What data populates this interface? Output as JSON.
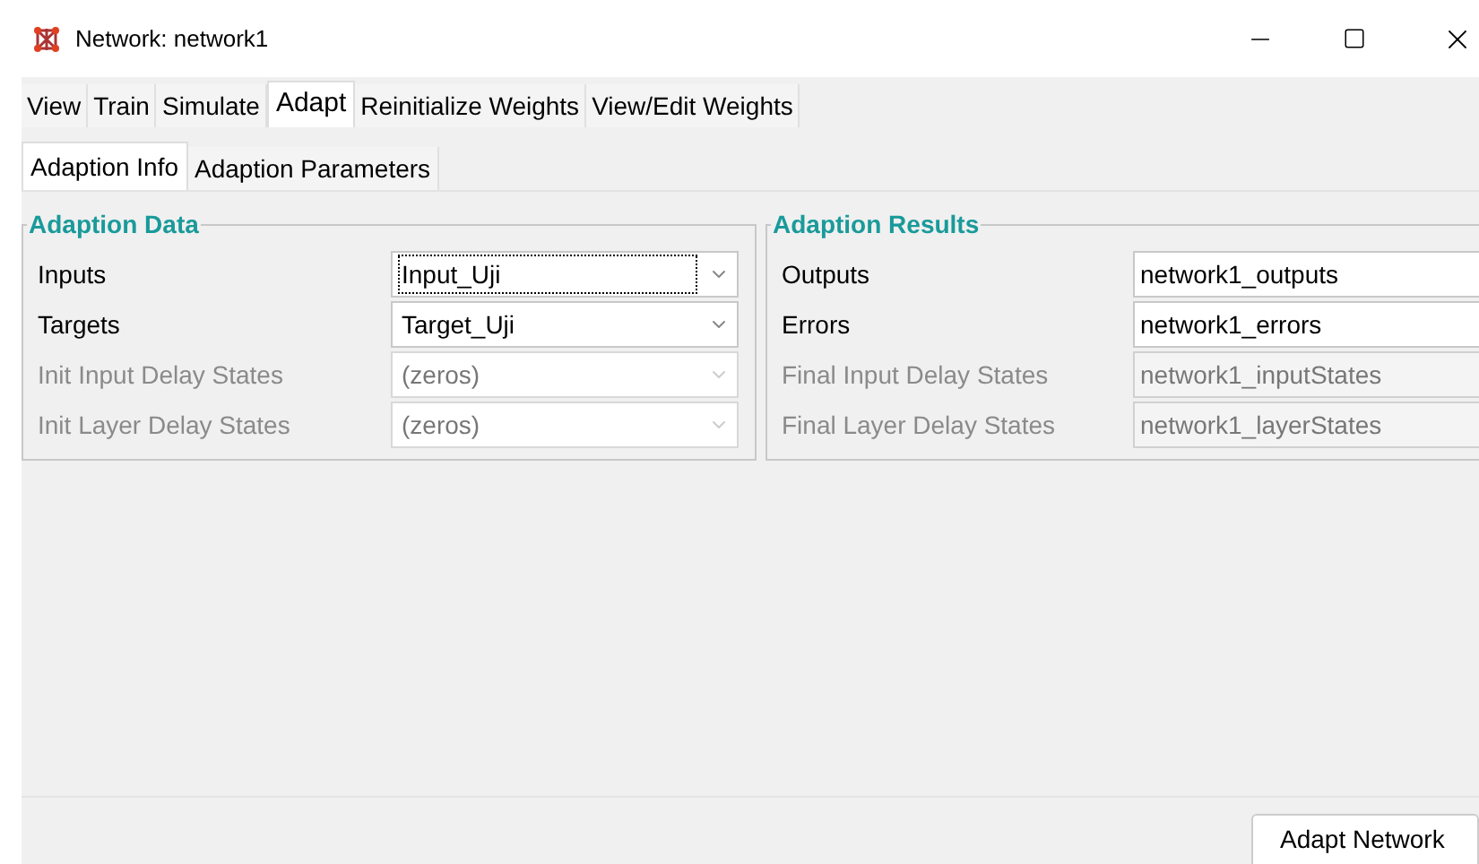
{
  "window": {
    "title": "Network: network1"
  },
  "tabs": [
    {
      "label": "View",
      "selected": false
    },
    {
      "label": "Train",
      "selected": false
    },
    {
      "label": "Simulate",
      "selected": false
    },
    {
      "label": "Adapt",
      "selected": true
    },
    {
      "label": "Reinitialize Weights",
      "selected": false
    },
    {
      "label": "View/Edit Weights",
      "selected": false
    }
  ],
  "subtabs": [
    {
      "label": "Adaption Info",
      "selected": true
    },
    {
      "label": "Adaption Parameters",
      "selected": false
    }
  ],
  "adaption_data": {
    "title": "Adaption Data",
    "rows": [
      {
        "label": "Inputs",
        "value": "Input_Uji",
        "disabled": false,
        "focused": true
      },
      {
        "label": "Targets",
        "value": "Target_Uji",
        "disabled": false,
        "focused": false
      },
      {
        "label": "Init Input Delay States",
        "value": "(zeros)",
        "disabled": true,
        "focused": false
      },
      {
        "label": "Init Layer Delay States",
        "value": "(zeros)",
        "disabled": true,
        "focused": false
      }
    ]
  },
  "adaption_results": {
    "title": "Adaption Results",
    "rows": [
      {
        "label": "Outputs",
        "value": "network1_outputs",
        "disabled": false
      },
      {
        "label": "Errors",
        "value": "network1_errors",
        "disabled": false
      },
      {
        "label": "Final Input Delay States",
        "value": "network1_inputStates",
        "disabled": true
      },
      {
        "label": "Final Layer Delay States",
        "value": "network1_layerStates",
        "disabled": true
      }
    ]
  },
  "buttons": [
    "Adapt Network"
  ]
}
